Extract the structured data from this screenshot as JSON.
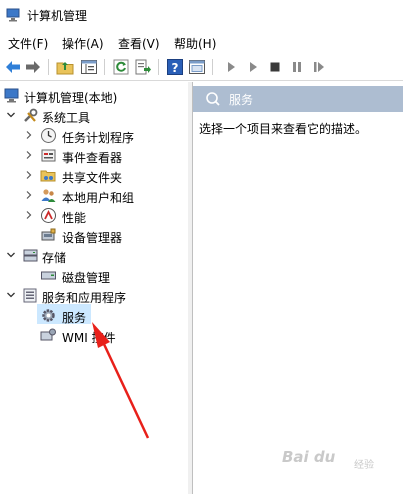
{
  "window": {
    "title": "计算机管理"
  },
  "menu": [
    "文件(F)",
    "操作(A)",
    "查看(V)",
    "帮助(H)"
  ],
  "toolbar": {
    "icons": [
      "back-icon",
      "forward-icon",
      "up-folder-icon",
      "show-hide-tree-icon",
      "refresh-icon",
      "export-icon",
      "help-icon",
      "properties-icon",
      "play-icon",
      "play-alt-icon",
      "stop-icon",
      "pause-icon",
      "restart-icon"
    ]
  },
  "tree": {
    "root": "计算机管理(本地)",
    "system_tools": "系统工具",
    "task_scheduler": "任务计划程序",
    "event_viewer": "事件查看器",
    "shared_folders": "共享文件夹",
    "local_users": "本地用户和组",
    "performance": "性能",
    "device_manager": "设备管理器",
    "storage": "存储",
    "disk_management": "磁盘管理",
    "services_apps": "服务和应用程序",
    "services": "服务",
    "wmi": "WMI 控件"
  },
  "right_pane": {
    "header": "服务",
    "description": "选择一个项目来查看它的描述。"
  },
  "watermark": {
    "brand": "Bai du",
    "sub": "经验"
  },
  "colors": {
    "selection": "#cce8ff",
    "header_bg": "#adbdd1",
    "arrow": "#e8201a"
  }
}
